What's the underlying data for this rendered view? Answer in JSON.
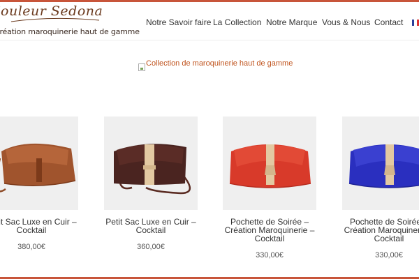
{
  "header": {
    "logo_script": "Couleur Sedona",
    "logo_tagline": "Création maroquinerie haut de gamme",
    "nav": [
      "Notre Savoir faire",
      "La Collection",
      "Notre Marque",
      "Vous & Nous",
      "Contact"
    ],
    "language_icon": "french-flag-icon"
  },
  "banner": {
    "alt_text": "Collection de maroquinerie haut de gamme",
    "icon": "broken-image-icon"
  },
  "products": [
    {
      "name_lines": [
        "Petit Sac Luxe en Cuir –",
        "Cocktail"
      ],
      "price": "380,00€",
      "bag_color": "#a0542d"
    },
    {
      "name_lines": [
        "Petit Sac Luxe en Cuir –",
        "Cocktail"
      ],
      "price": "360,00€",
      "bag_color": "#4a2420"
    },
    {
      "name_lines": [
        "Pochette de Soirée –",
        "Création Maroquinerie –",
        "Cocktail"
      ],
      "price": "330,00€",
      "bag_color": "#d83a2a"
    },
    {
      "name_lines": [
        "Pochette de Soirée –",
        "Création Maroquinerie –",
        "Cocktail"
      ],
      "price": "330,00€",
      "bag_color": "#2a2fbf"
    }
  ],
  "colors": {
    "accent": "#c8553a",
    "strap": "#e3c9a2"
  }
}
